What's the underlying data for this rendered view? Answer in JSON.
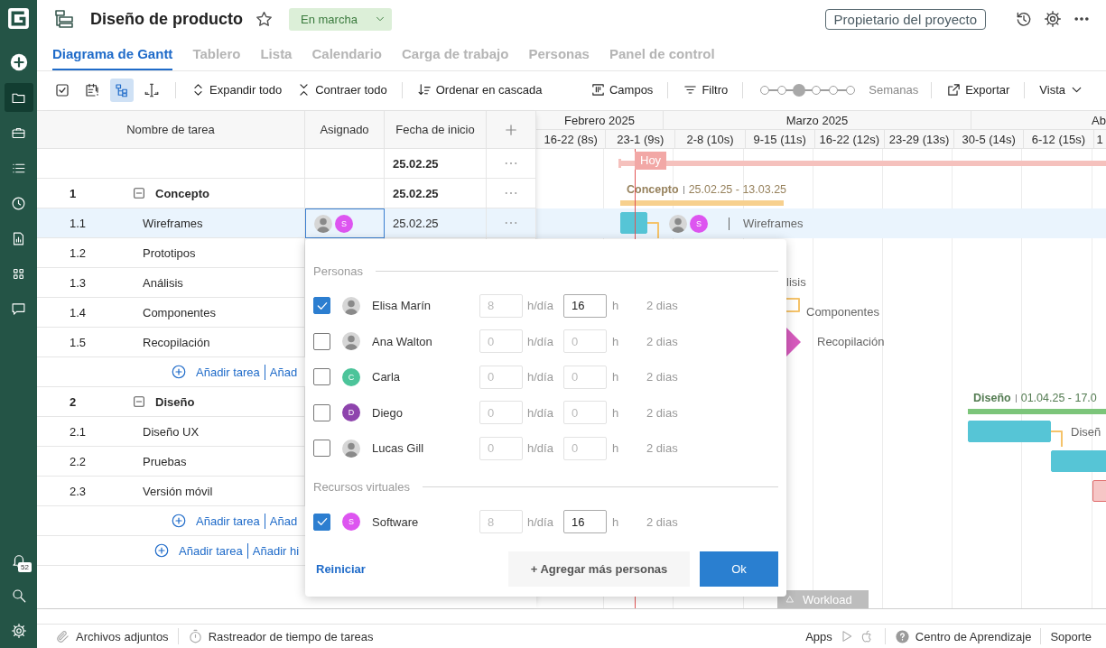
{
  "sidebar": {
    "items": [
      {
        "kind": "add",
        "selected": false
      },
      {
        "kind": "folder",
        "selected": true
      },
      {
        "kind": "briefcase",
        "selected": false
      },
      {
        "kind": "list",
        "selected": false
      },
      {
        "kind": "clock",
        "selected": false
      },
      {
        "kind": "report",
        "selected": false
      },
      {
        "kind": "apps",
        "selected": false
      },
      {
        "kind": "chat",
        "selected": false
      }
    ],
    "bottom_items": [
      {
        "kind": "notifications",
        "badge": "52"
      },
      {
        "kind": "search"
      },
      {
        "kind": "settings"
      }
    ]
  },
  "header": {
    "title": "Diseño de producto",
    "starred": false,
    "status": "En marcha",
    "owner_button": "Propietario del proyecto"
  },
  "tabs": [
    {
      "label": "Diagrama de Gantt",
      "selected": true
    },
    {
      "label": "Tablero",
      "selected": false
    },
    {
      "label": "Lista",
      "selected": false
    },
    {
      "label": "Calendario",
      "selected": false
    },
    {
      "label": "Carga de trabajo",
      "selected": false
    },
    {
      "label": "Personas",
      "selected": false
    },
    {
      "label": "Panel de control",
      "selected": false
    }
  ],
  "toolbar": {
    "icon_tools": [
      {
        "kind": "check",
        "selected": false
      },
      {
        "kind": "calendar",
        "selected": false
      },
      {
        "kind": "hierarchy",
        "selected": true
      },
      {
        "kind": "resize",
        "selected": false
      }
    ],
    "actions": [
      {
        "kind": "expand",
        "label": "Expandir todo"
      },
      {
        "kind": "collapse",
        "label": "Contraer todo"
      },
      {
        "kind": "sort",
        "label": "Ordenar en cascada"
      }
    ],
    "fields": "Campos",
    "filter": "Filtro",
    "zoom": {
      "level": 0.4,
      "label": "Semanas"
    },
    "export": "Exportar",
    "view": "Vista"
  },
  "table": {
    "columns": [
      "Nombre de tarea",
      "Asignado",
      "Fecha de inicio"
    ],
    "rows": [
      {
        "kind": "summary",
        "selected": false,
        "start": "25.02.25",
        "bar": {
          "kind": "summary",
          "color": "#f5c1bd",
          "today_label": "Hoy"
        }
      },
      {
        "kind": "group",
        "selected": false,
        "number": "1",
        "name": "Concepto",
        "expanded": true,
        "start": "25.02.25",
        "bar": {
          "kind": "group",
          "label": "Concepto",
          "dates": "25.02.25 - 13.03.25",
          "color": "#f7d08e"
        }
      },
      {
        "kind": "task",
        "selected": true,
        "number": "1.1",
        "name": "Wireframes",
        "start": "25.02.25",
        "assignees": [
          {
            "kind": "photo"
          },
          {
            "kind": "initial",
            "initial": "S",
            "color": "#dd55f0"
          }
        ],
        "bar": {
          "kind": "task",
          "color": "#56c5d6",
          "label": "Wireframes",
          "linked": true,
          "assignees": [
            {
              "kind": "photo"
            },
            {
              "kind": "initial",
              "initial": "S",
              "color": "#dd55f0"
            }
          ]
        }
      },
      {
        "kind": "task",
        "selected": false,
        "number": "1.2",
        "name": "Prototipos"
      },
      {
        "kind": "task",
        "selected": false,
        "number": "1.3",
        "name": "Análisis",
        "bar": {
          "kind": "label_only",
          "label": "lisis"
        }
      },
      {
        "kind": "task",
        "selected": false,
        "number": "1.4",
        "name": "Componentes",
        "bar": {
          "kind": "label_only",
          "label": "Componentes",
          "linked": true
        }
      },
      {
        "kind": "task",
        "selected": false,
        "number": "1.5",
        "name": "Recopilación",
        "bar": {
          "kind": "milestone",
          "label": "Recopilación",
          "color": "#d65bbd"
        }
      },
      {
        "kind": "add",
        "selected": false,
        "links": [
          "Añadir tarea",
          "Añad"
        ]
      },
      {
        "kind": "group",
        "selected": false,
        "number": "2",
        "name": "Diseño",
        "expanded": true,
        "bar": {
          "kind": "group",
          "label": "Diseño",
          "dates": "01.04.25 - 17.0",
          "color": "#7cc57a"
        }
      },
      {
        "kind": "task",
        "selected": false,
        "number": "2.1",
        "name": "Diseño UX",
        "bar": {
          "kind": "task",
          "color": "#56c5d6",
          "label": "Diseñ",
          "linked": true
        }
      },
      {
        "kind": "task",
        "selected": false,
        "number": "2.2",
        "name": "Pruebas",
        "bar": {
          "kind": "task",
          "color": "#56c5d6"
        }
      },
      {
        "kind": "task",
        "selected": false,
        "number": "2.3",
        "name": "Versión móvil",
        "bar": {
          "kind": "task",
          "color": "#f6c6c6"
        }
      },
      {
        "kind": "add",
        "selected": false,
        "links": [
          "Añadir tarea",
          "Añad"
        ]
      },
      {
        "kind": "add_root",
        "selected": false,
        "links": [
          "Añadir tarea",
          "Añadir hi"
        ]
      }
    ]
  },
  "gantt": {
    "months": [
      "Febrero 2025",
      "Marzo 2025",
      "Ab"
    ],
    "weeks": [
      "16-22 (8s)",
      "23-1 (9s)",
      "2-8 (10s)",
      "9-15 (11s)",
      "16-22 (12s)",
      "23-29 (13s)",
      "30-5 (14s)",
      "6-12 (15s)",
      "1"
    ],
    "workload_tab": "Workload"
  },
  "popup": {
    "sections": [
      {
        "title": "Personas",
        "people": [
          {
            "name": "Elisa Marín",
            "checked": true,
            "avatar": {
              "kind": "photo"
            },
            "per_day": "8",
            "per_day_unit": "h/día",
            "total": "16",
            "total_unit": "h",
            "duration": "2 dias"
          },
          {
            "name": "Ana Walton",
            "checked": false,
            "avatar": {
              "kind": "photo"
            },
            "per_day": "0",
            "per_day_unit": "h/día",
            "total": "0",
            "total_unit": "h",
            "duration": "2 dias"
          },
          {
            "name": "Carla",
            "checked": false,
            "avatar": {
              "kind": "initial",
              "initial": "C",
              "color": "#4cc49a"
            },
            "per_day": "0",
            "per_day_unit": "h/día",
            "total": "0",
            "total_unit": "h",
            "duration": "2 dias"
          },
          {
            "name": "Diego",
            "checked": false,
            "avatar": {
              "kind": "initial",
              "initial": "D",
              "color": "#8e44ad"
            },
            "per_day": "0",
            "per_day_unit": "h/día",
            "total": "0",
            "total_unit": "h",
            "duration": "2 dias"
          },
          {
            "name": "Lucas Gill",
            "checked": false,
            "avatar": {
              "kind": "photo"
            },
            "per_day": "0",
            "per_day_unit": "h/día",
            "total": "0",
            "total_unit": "h",
            "duration": "2 dias"
          }
        ]
      },
      {
        "title": "Recursos virtuales",
        "people": [
          {
            "name": "Software",
            "checked": true,
            "avatar": {
              "kind": "initial",
              "initial": "S",
              "color": "#dd55f0"
            },
            "per_day": "8",
            "per_day_unit": "h/día",
            "total": "16",
            "total_unit": "h",
            "duration": "2 dias"
          }
        ]
      }
    ],
    "reset": "Reiniciar",
    "add_more": "+ Agregar más personas",
    "ok": "Ok"
  },
  "footer": {
    "left": [
      {
        "kind": "attachments",
        "label": "Archivos adjuntos"
      },
      {
        "kind": "timer",
        "label": "Rastreador de tiempo de tareas"
      }
    ],
    "apps": "Apps",
    "help": "Centro de Aprendizaje",
    "support": "Soporte"
  }
}
